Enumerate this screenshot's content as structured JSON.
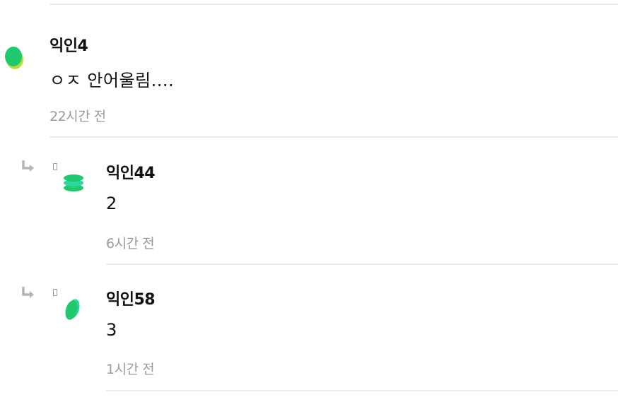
{
  "comments": [
    {
      "author": "익인4",
      "text": "ㅇㅈ 안어울림....",
      "time": "22시간 전"
    }
  ],
  "replies": [
    {
      "author": "익인44",
      "text": "2",
      "time": "6시간 전"
    },
    {
      "author": "익인58",
      "text": "3",
      "time": "1시간 전"
    }
  ],
  "icons": {
    "reply": "reply-arrow-icon",
    "avatar": "avatar-icon"
  },
  "colors": {
    "avatar_green": "#1fc96f",
    "avatar_yellow": "#b8dd3a",
    "avatar_teal": "#2fd6a0",
    "muted": "#9a9a9a",
    "divider": "#ececec"
  }
}
